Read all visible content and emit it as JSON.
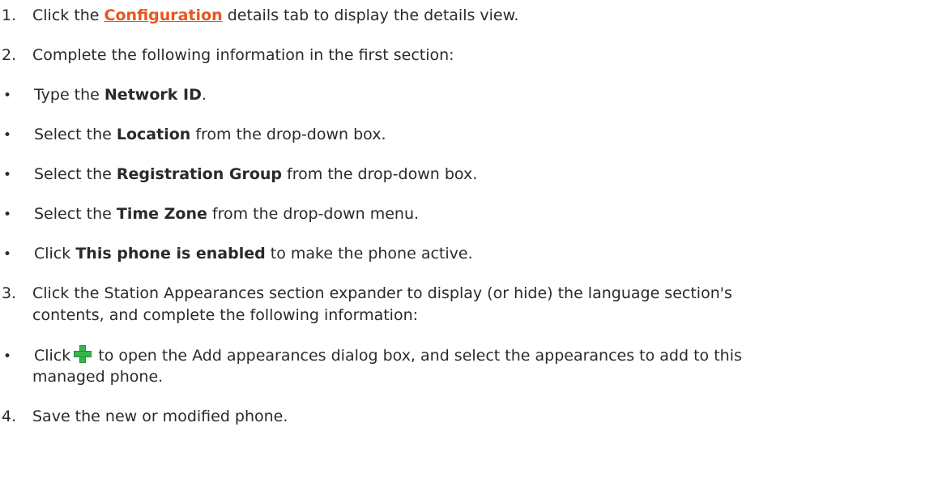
{
  "steps": {
    "s1": {
      "num": "1.",
      "pre": "Click the ",
      "link": "Configuration",
      "post": " details tab to display the details view."
    },
    "s2": {
      "num": "2.",
      "text": "Complete the following information in the first section:"
    },
    "b1": {
      "pre": "Type the ",
      "bold": "Network ID",
      "post": "."
    },
    "b2": {
      "pre": "Select the ",
      "bold": "Location",
      "post": " from the drop-down box."
    },
    "b3": {
      "pre": "Select the ",
      "bold": "Registration Group",
      "post": " from the drop-down box."
    },
    "b4": {
      "pre": "Select the ",
      "bold": "Time Zone",
      "post": " from the drop-down menu."
    },
    "b5": {
      "pre": "Click ",
      "bold": "This phone is enabled",
      "post": " to make the phone active."
    },
    "s3": {
      "num": "3.",
      "line1": "Click the Station Appearances section expander to display (or hide) the language section's",
      "line2": "contents, and complete the following information:"
    },
    "b6": {
      "pre": "Click",
      "icon": "add-plus-icon",
      "line1": " to open the Add appearances dialog box, and select the appearances to add to this",
      "line2": "managed phone."
    },
    "s4": {
      "num": "4.",
      "text": "Save the new or modified phone."
    }
  },
  "bullet_char": "•",
  "colors": {
    "link": "#e8561f",
    "plus_icon": "#39b54a",
    "text": "#2a2a2a"
  }
}
